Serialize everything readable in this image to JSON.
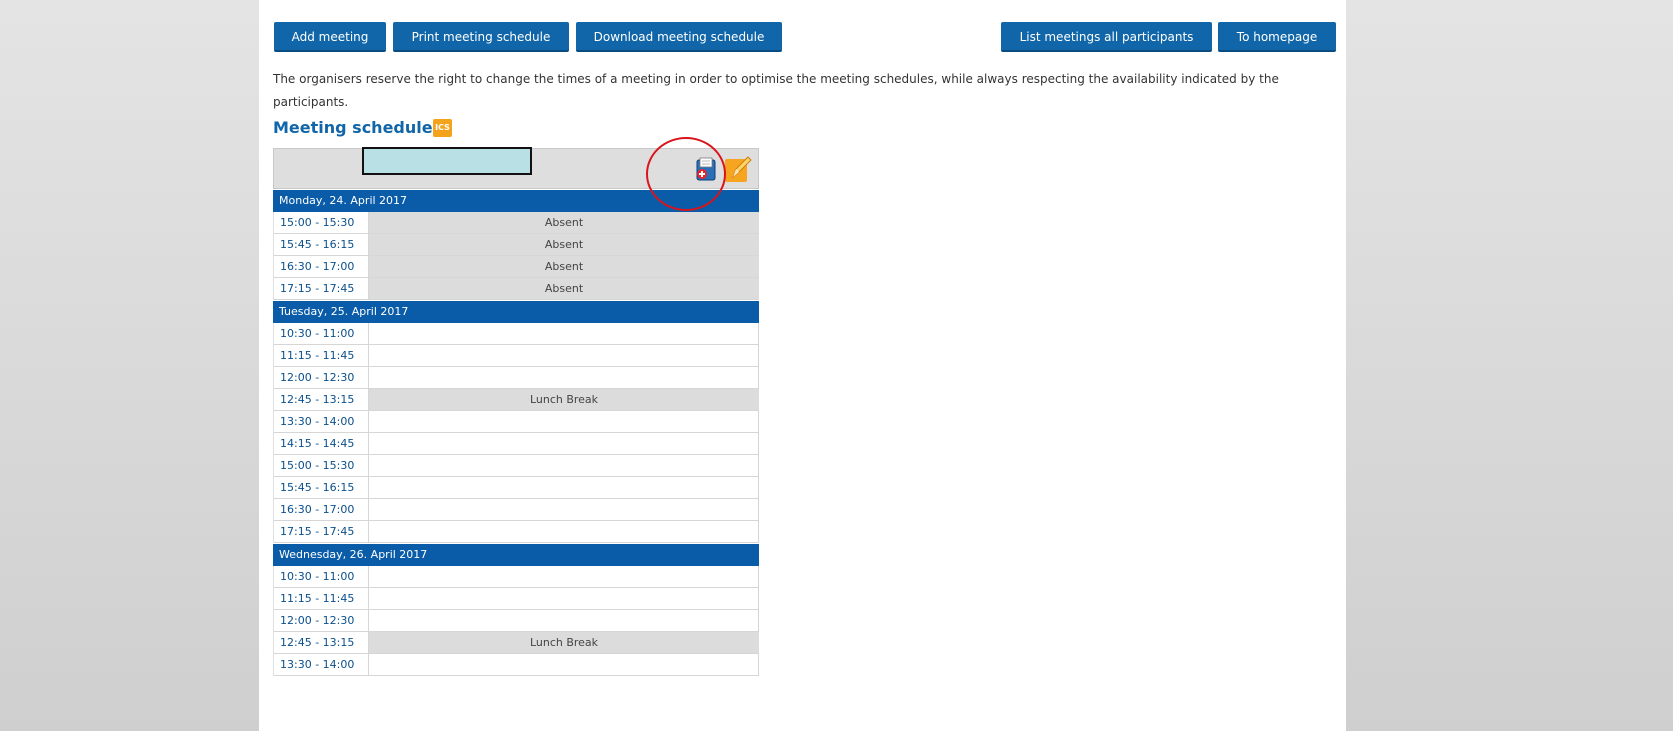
{
  "toolbar": {
    "add_meeting": "Add meeting",
    "print_schedule": "Print meeting schedule",
    "download_schedule": "Download meeting schedule",
    "list_meetings": "List meetings all participants",
    "to_homepage": "To homepage"
  },
  "notice": "The organisers reserve the right to change the times of a meeting in order to optimise the meeting schedules, while always respecting the availability indicated by the participants.",
  "schedule": {
    "title": "Meeting schedule",
    "ics_label": "ICS",
    "days": [
      {
        "label": "Monday, 24. April 2017",
        "slots": [
          {
            "time": "15:00 - 15:30",
            "status": "Absent"
          },
          {
            "time": "15:45 - 16:15",
            "status": "Absent"
          },
          {
            "time": "16:30 - 17:00",
            "status": "Absent"
          },
          {
            "time": "17:15 - 17:45",
            "status": "Absent"
          }
        ]
      },
      {
        "label": "Tuesday, 25. April 2017",
        "slots": [
          {
            "time": "10:30 - 11:00",
            "status": ""
          },
          {
            "time": "11:15 - 11:45",
            "status": ""
          },
          {
            "time": "12:00 - 12:30",
            "status": ""
          },
          {
            "time": "12:45 - 13:15",
            "status": "Lunch Break"
          },
          {
            "time": "13:30 - 14:00",
            "status": ""
          },
          {
            "time": "14:15 - 14:45",
            "status": ""
          },
          {
            "time": "15:00 - 15:30",
            "status": ""
          },
          {
            "time": "15:45 - 16:15",
            "status": ""
          },
          {
            "time": "16:30 - 17:00",
            "status": ""
          },
          {
            "time": "17:15 - 17:45",
            "status": ""
          }
        ]
      },
      {
        "label": "Wednesday, 26. April 2017",
        "slots": [
          {
            "time": "10:30 - 11:00",
            "status": ""
          },
          {
            "time": "11:15 - 11:45",
            "status": ""
          },
          {
            "time": "12:00 - 12:30",
            "status": ""
          },
          {
            "time": "12:45 - 13:15",
            "status": "Lunch Break"
          },
          {
            "time": "13:30 - 14:00",
            "status": ""
          }
        ]
      }
    ]
  },
  "icons": {
    "add_meeting_icon": "calendar-add-icon",
    "edit_icon": "pencil-edit-icon",
    "ics_icon": "ics-calendar-icon"
  },
  "colors": {
    "button_bg": "#1066a8",
    "day_header_bg": "#0a5ca8",
    "highlight_circle": "#d9141b",
    "ics_orange": "#f3a31c"
  }
}
